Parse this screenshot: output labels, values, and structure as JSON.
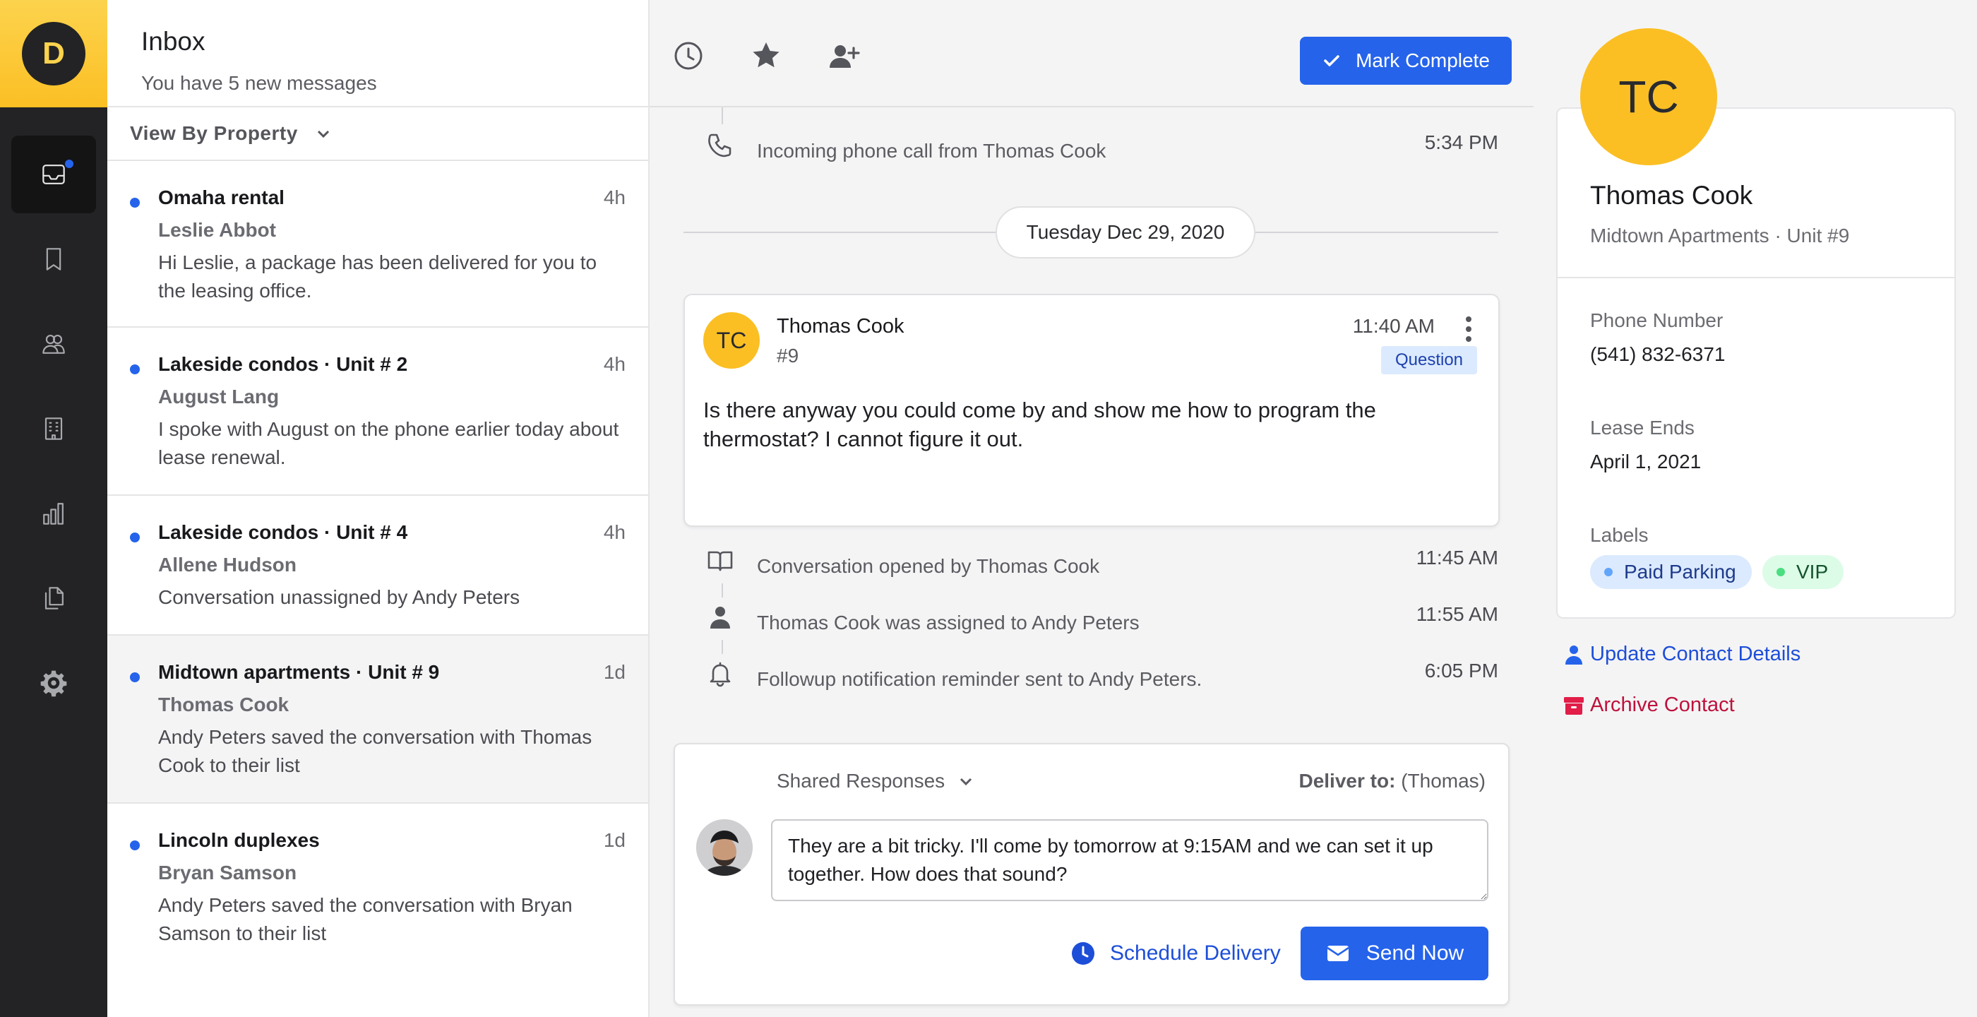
{
  "rail": {
    "logo_letter": "D",
    "items": [
      {
        "icon": "inbox-icon",
        "active": true
      },
      {
        "icon": "bookmark-icon"
      },
      {
        "icon": "users-icon"
      },
      {
        "icon": "building-icon"
      },
      {
        "icon": "bar-chart-icon"
      },
      {
        "icon": "documents-icon"
      },
      {
        "icon": "gear-icon"
      }
    ]
  },
  "inbox": {
    "title": "Inbox",
    "subtitle": "You have 5 new messages",
    "view_by_label": "View By Property",
    "messages": [
      {
        "property": "Omaha rental",
        "age": "4h",
        "person": "Leslie Abbot",
        "snippet": "Hi Leslie, a package has been delivered for you to the leasing office."
      },
      {
        "property": "Lakeside condos · Unit # 2",
        "age": "4h",
        "person": "August Lang",
        "snippet": "I spoke with August on the phone earlier today about lease renewal."
      },
      {
        "property": "Lakeside condos · Unit # 4",
        "age": "4h",
        "person": "Allene Hudson",
        "snippet": "Conversation unassigned by Andy Peters"
      },
      {
        "property": "Midtown apartments · Unit # 9",
        "age": "1d",
        "person": "Thomas Cook",
        "snippet": "Andy Peters saved the conversation with Thomas Cook to their list"
      },
      {
        "property": "Lincoln duplexes",
        "age": "1d",
        "person": "Bryan Samson",
        "snippet": "Andy Peters saved the conversation with Bryan Samson to their list"
      }
    ]
  },
  "toolbar": {
    "mark_complete_label": "Mark Complete"
  },
  "conversation": {
    "phone_event": {
      "text": "Incoming phone call from Thomas Cook",
      "time": "5:34 PM"
    },
    "date_separator": "Tuesday Dec 29, 2020",
    "message": {
      "avatar_initials": "TC",
      "name": "Thomas Cook",
      "unit": "#9",
      "time": "11:40 AM",
      "tag": "Question",
      "body": "Is there anyway you could come by and show me how to program the thermostat? I cannot figure it out."
    },
    "events": [
      {
        "icon": "book-icon",
        "text": "Conversation opened by Thomas Cook",
        "time": "11:45 AM"
      },
      {
        "icon": "person-icon",
        "text": "Thomas Cook was assigned to Andy Peters",
        "time": "11:55 AM"
      },
      {
        "icon": "bell-icon",
        "text": "Followup notification reminder sent to Andy Peters.",
        "time": "6:05 PM"
      }
    ]
  },
  "composer": {
    "shared_responses_label": "Shared Responses",
    "deliver_to_label": "Deliver to:",
    "deliver_to_value": "(Thomas)",
    "reply_text": "They are a bit tricky. I'll come by tomorrow at 9:15AM and we can set it up together. How does that sound?",
    "schedule_label": "Schedule Delivery",
    "send_label": "Send Now"
  },
  "contact": {
    "initials": "TC",
    "name": "Thomas Cook",
    "location": "Midtown Apartments · Unit #9",
    "phone_label": "Phone Number",
    "phone_value": "(541) 832-6371",
    "lease_label": "Lease Ends",
    "lease_value": "April 1, 2021",
    "labels_label": "Labels",
    "labels": [
      "Paid Parking",
      "VIP"
    ],
    "update_link": "Update Contact Details",
    "archive_link": "Archive Contact"
  },
  "colors": {
    "accent_blue": "#2563eb",
    "brand_yellow": "#fbbf24",
    "rail_dark": "#232325",
    "danger": "#be123c"
  }
}
